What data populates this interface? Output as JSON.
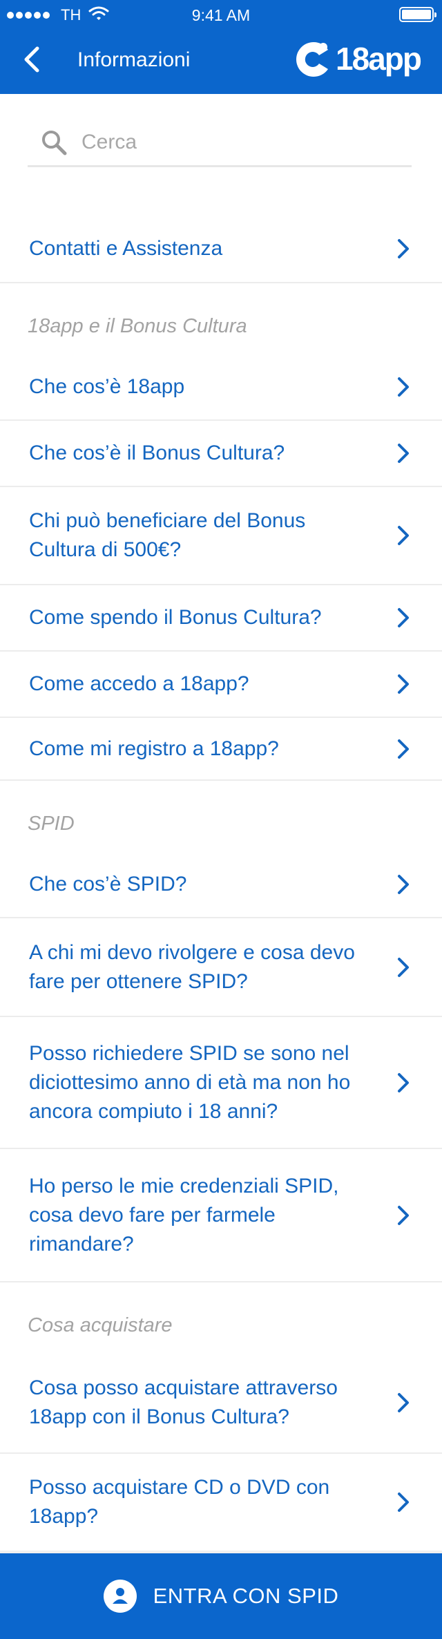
{
  "status_bar": {
    "carrier": "TH",
    "time": "9:41 AM"
  },
  "header": {
    "title": "Informazioni",
    "brand": "18app"
  },
  "search": {
    "placeholder": "Cerca"
  },
  "top_items": [
    {
      "label": "Contatti e Assistenza"
    }
  ],
  "sections": [
    {
      "title": "18app e il Bonus Cultura",
      "items": [
        {
          "label": "Che cos’è 18app"
        },
        {
          "label": "Che cos’è il Bonus Cultura?"
        },
        {
          "label": "Chi può beneficiare del Bonus\nCultura di 500€?"
        },
        {
          "label": "Come spendo il Bonus Cultura?"
        },
        {
          "label": "Come accedo a 18app?"
        },
        {
          "label": "Come mi registro a 18app?"
        }
      ]
    },
    {
      "title": "SPID",
      "items": [
        {
          "label": "Che cos’è SPID?"
        },
        {
          "label": "A chi mi devo rivolgere e cosa devo\nfare per ottenere SPID?"
        },
        {
          "label": "Posso richiedere SPID se sono nel\ndiciottesimo anno di età ma non ho\nancora compiuto i 18 anni?"
        },
        {
          "label": "Ho perso le mie credenziali SPID,\ncosa devo fare per farmele\nrimandare?"
        }
      ]
    },
    {
      "title": "Cosa acquistare",
      "items": [
        {
          "label": "Cosa posso acquistare attraverso\n18app con il Bonus Cultura?"
        },
        {
          "label": "Posso acquistare CD o DVD con\n18app?"
        }
      ]
    }
  ],
  "cta": {
    "label": "ENTRA CON SPID",
    "icon": "user-icon"
  },
  "colors": {
    "brand_blue": "#0b66cc",
    "link_blue": "#1466c0",
    "section_gray": "#a3a3a3"
  }
}
